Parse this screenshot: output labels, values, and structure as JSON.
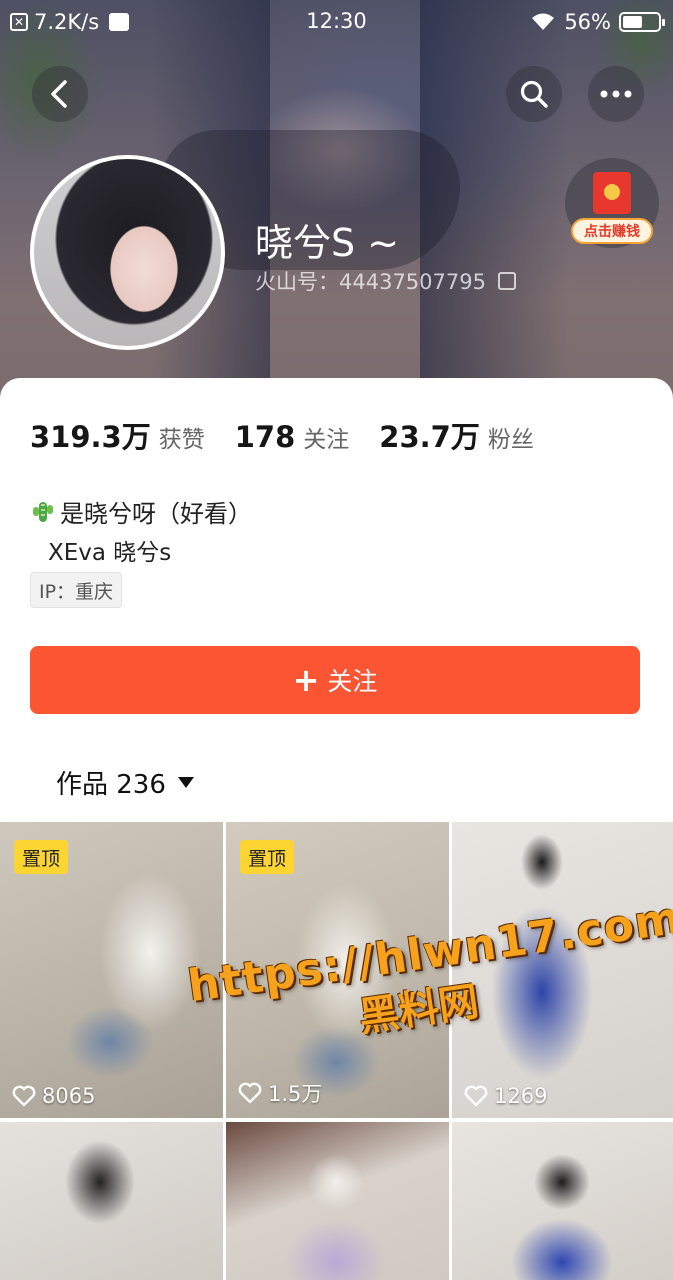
{
  "status_bar": {
    "net_speed": "7.2K/s",
    "time": "12:30",
    "battery": "56%",
    "battery_level": 0.56
  },
  "nav": {
    "back_icon": "chevron-left-icon",
    "search_icon": "search-icon",
    "more_icon": "more-icon"
  },
  "promo": {
    "cta": "点击赚钱"
  },
  "profile": {
    "name": "晓兮S ~",
    "id_label": "火山号：44437507795",
    "stats": [
      {
        "num": "319.3万",
        "label": "获赞"
      },
      {
        "num": "178",
        "label": "关注"
      },
      {
        "num": "23.7万",
        "label": "粉丝"
      }
    ],
    "bio_line1": "是晓兮呀（好看）",
    "bio_line2": "XEva 晓兮s",
    "ip": "IP：重庆",
    "follow_plus": "+",
    "follow_label": "关注"
  },
  "works": {
    "tab_label": "作品 236"
  },
  "grid": {
    "pin_label": "置顶",
    "tiles": [
      {
        "pinned": true,
        "likes": "8065"
      },
      {
        "pinned": true,
        "likes": "1.5万"
      },
      {
        "pinned": false,
        "likes": "1269"
      },
      {
        "pinned": false,
        "likes": ""
      },
      {
        "pinned": false,
        "likes": ""
      },
      {
        "pinned": false,
        "likes": ""
      }
    ]
  },
  "watermark": {
    "url": "https://hlwn17.com",
    "cn": "黑料网"
  },
  "colors": {
    "accent": "#fb5534",
    "pin": "#fdd532",
    "watermark": "#f7a21c"
  }
}
